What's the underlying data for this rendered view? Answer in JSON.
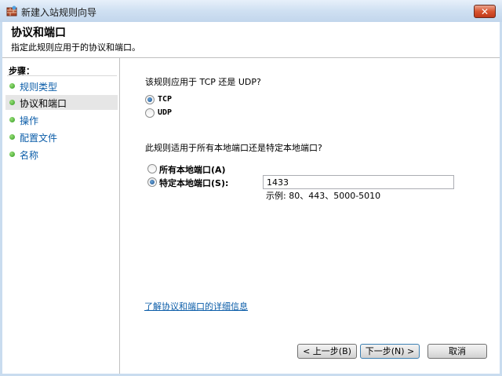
{
  "window": {
    "title": "新建入站规则向导",
    "close_glyph": "✕"
  },
  "header": {
    "title": "协议和端口",
    "subtitle": "指定此规则应用于的协议和端口。"
  },
  "steps": {
    "label": "步骤：",
    "items": [
      {
        "label": "规则类型"
      },
      {
        "label": "协议和端口",
        "active": true
      },
      {
        "label": "操作"
      },
      {
        "label": "配置文件"
      },
      {
        "label": "名称"
      }
    ]
  },
  "protocol": {
    "question": "该规则应用于 TCP 还是 UDP?",
    "options": [
      {
        "label": "TCP",
        "checked": true
      },
      {
        "label": "UDP",
        "checked": false
      }
    ]
  },
  "ports": {
    "question": "此规则适用于所有本地端口还是特定本地端口?",
    "options": [
      {
        "label": "所有本地端口(A)",
        "checked": false
      },
      {
        "label": "特定本地端口(S):",
        "checked": true
      }
    ],
    "value": "1433",
    "example": "示例: 80、443、5000-5010"
  },
  "link": {
    "label": "了解协议和端口的详细信息"
  },
  "buttons": {
    "back": "< 上一步(B)",
    "next": "下一步(N) >",
    "cancel": "取消"
  },
  "colors": {
    "link": "#0a5ca8",
    "step_dot": "#2f9a1f",
    "close_button": "#c0391a"
  }
}
